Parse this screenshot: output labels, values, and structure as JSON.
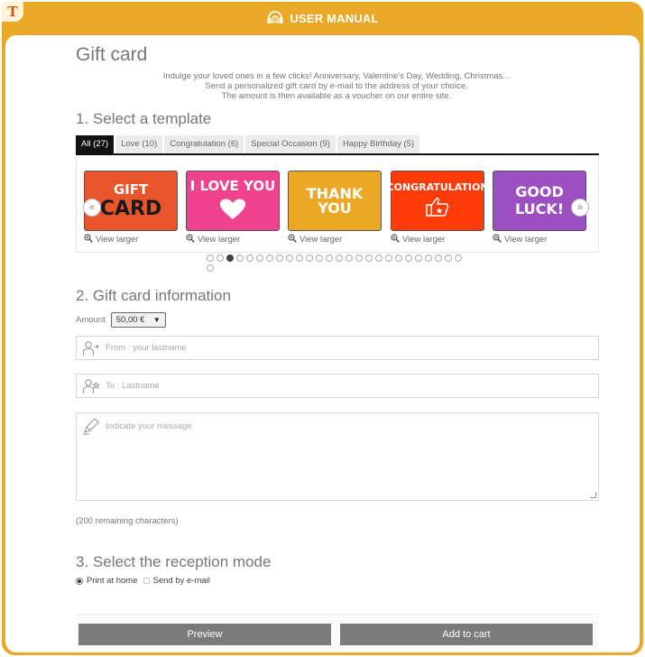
{
  "brand": {
    "logo_letter": "T",
    "accent": "#e9a825"
  },
  "header": {
    "title": "USER MANUAL"
  },
  "page": {
    "title": "Gift card",
    "intro": [
      "Indulge your loved ones in a few clicks! Anniversary, Valentine's Day, Wedding, Christmas...",
      "Send a personalized gift card by e-mail to the address of your choice.",
      "The amount is then available as a voucher on our entire site."
    ]
  },
  "template_section": {
    "heading": "1. Select a template",
    "tabs": [
      {
        "label": "All (27)",
        "active": true
      },
      {
        "label": "Love (10)",
        "active": false
      },
      {
        "label": "Congratulation (6)",
        "active": false
      },
      {
        "label": "Special Occasion (9)",
        "active": false
      },
      {
        "label": "Happy Birthday (5)",
        "active": false
      }
    ],
    "cards": [
      {
        "line1": "GIFT",
        "line2": "CARD",
        "color": "#e8552a",
        "view_label": "View larger"
      },
      {
        "line1": "I LOVE YOU",
        "line2": "",
        "color": "#f0438e",
        "view_label": "View larger"
      },
      {
        "line1": "THANK YOU",
        "line2": "",
        "color": "#eaa825",
        "view_label": "View larger"
      },
      {
        "line1": "CONGRATULATION",
        "line2": "",
        "color": "#ff3b0a",
        "view_label": "View larger"
      },
      {
        "line1": "GOOD",
        "line2": "LUCK!",
        "color": "#9b4fc0",
        "view_label": "View larger"
      }
    ],
    "prev_arrow": "«",
    "next_arrow": "»",
    "dot_count": 27,
    "active_dot": 3
  },
  "info_section": {
    "heading": "2. Gift card information",
    "amount_label": "Amount",
    "amount_value": "50,00 €",
    "from_placeholder": "From : your lastname",
    "to_placeholder": "To : Lastname",
    "message_placeholder": "Indicate your message",
    "remaining": "(200 remaining characters)"
  },
  "reception_section": {
    "heading": "3. Select the reception mode",
    "options": [
      {
        "label": "Print at home",
        "checked": true
      },
      {
        "label": "Send by e-mail",
        "checked": false
      }
    ]
  },
  "actions": {
    "preview_label": "Preview",
    "add_to_cart_label": "Add to cart"
  }
}
